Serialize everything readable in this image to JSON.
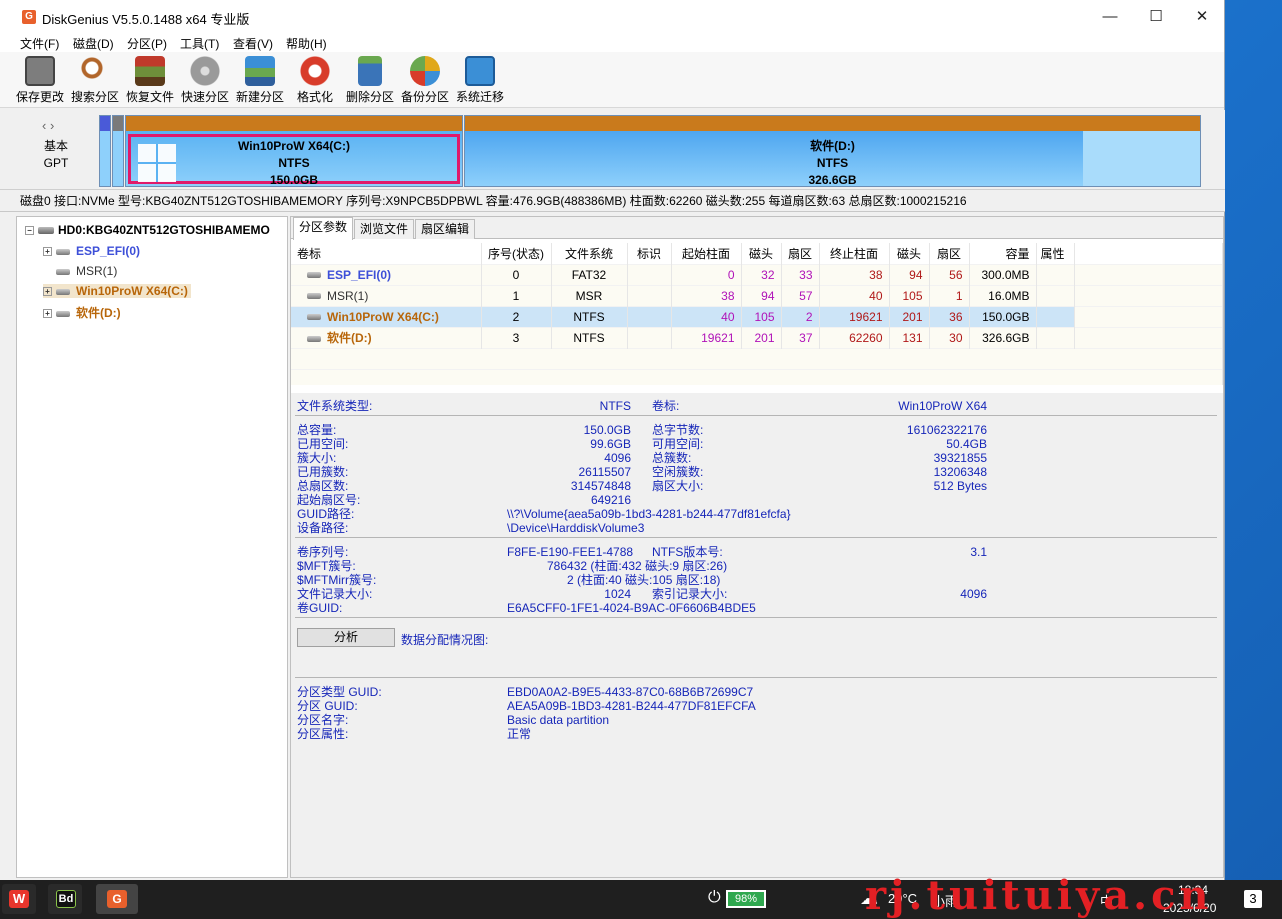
{
  "window": {
    "title": "DiskGenius V5.5.0.1488 x64 专业版",
    "min": "—",
    "max": "☐",
    "close": "✕"
  },
  "menu": [
    "文件(F)",
    "磁盘(D)",
    "分区(P)",
    "工具(T)",
    "查看(V)",
    "帮助(H)"
  ],
  "toolbar": [
    {
      "label": "保存更改",
      "icon": "save-icon",
      "color": "#7d7d7d"
    },
    {
      "label": "搜索分区",
      "icon": "search-icon",
      "color": "#b2662b"
    },
    {
      "label": "恢复文件",
      "icon": "recover-icon",
      "color": "#6e8f3a"
    },
    {
      "label": "快速分区",
      "icon": "quick-partition-icon",
      "color": "#9a9a9a"
    },
    {
      "label": "新建分区",
      "icon": "new-partition-icon",
      "color": "#2f7fc1"
    },
    {
      "label": "格式化",
      "icon": "format-icon",
      "color": "#d83c2a"
    },
    {
      "label": "删除分区",
      "icon": "delete-icon",
      "color": "#3a74b8"
    },
    {
      "label": "备份分区",
      "icon": "backup-icon",
      "color": "#e0a81a"
    },
    {
      "label": "系统迁移",
      "icon": "migrate-icon",
      "color": "#3b8fd6"
    }
  ],
  "diskmap": {
    "label_line1": "基本",
    "label_line2": "GPT",
    "segments": [
      {
        "name": "Win10ProW X64(C:)",
        "fs": "NTFS",
        "size": "150.0GB"
      },
      {
        "name": "软件(D:)",
        "fs": "NTFS",
        "size": "326.6GB"
      }
    ]
  },
  "diskinfo": "磁盘0 接口:NVMe  型号:KBG40ZNT512GTOSHIBAMEMORY  序列号:X9NPCB5DPBWL  容量:476.9GB(488386MB)  柱面数:62260  磁头数:255  每道扇区数:63  总扇区数:1000215216",
  "tree": {
    "root": "HD0:KBG40ZNT512GTOSHIBAMEMO",
    "items": [
      {
        "label": "ESP_EFI(0)",
        "color": "#3d4fd8"
      },
      {
        "label": "MSR(1)",
        "color": "#333333"
      },
      {
        "label": "Win10ProW X64(C:)",
        "color": "#b8660a"
      },
      {
        "label": "软件(D:)",
        "color": "#b8660a"
      }
    ]
  },
  "tabs": [
    "分区参数",
    "浏览文件",
    "扇区编辑"
  ],
  "table": {
    "headers": [
      "卷标",
      "序号(状态)",
      "文件系统",
      "标识",
      "起始柱面",
      "磁头",
      "扇区",
      "终止柱面",
      "磁头",
      "扇区",
      "容量",
      "属性"
    ],
    "rows": [
      {
        "name": "ESP_EFI(0)",
        "idx": "0",
        "fs": "FAT32",
        "sc": "0",
        "sh": "32",
        "ss": "33",
        "ec": "38",
        "eh": "94",
        "es": "56",
        "cap": "300.0MB"
      },
      {
        "name": "MSR(1)",
        "idx": "1",
        "fs": "MSR",
        "sc": "38",
        "sh": "94",
        "ss": "57",
        "ec": "40",
        "eh": "105",
        "es": "1",
        "cap": "16.0MB"
      },
      {
        "name": "Win10ProW X64(C:)",
        "idx": "2",
        "fs": "NTFS",
        "sc": "40",
        "sh": "105",
        "ss": "2",
        "ec": "19621",
        "eh": "201",
        "es": "36",
        "cap": "150.0GB"
      },
      {
        "name": "软件(D:)",
        "idx": "3",
        "fs": "NTFS",
        "sc": "19621",
        "sh": "201",
        "ss": "37",
        "ec": "62260",
        "eh": "131",
        "es": "30",
        "cap": "326.6GB"
      }
    ]
  },
  "details": {
    "fstype_label": "文件系统类型:",
    "fstype": "NTFS",
    "vol_label": "卷标:",
    "vol": "Win10ProW X64",
    "total_label": "总容量:",
    "total": "150.0GB",
    "bytes_label": "总字节数:",
    "bytes": "161062322176",
    "used_label": "已用空间:",
    "used": "99.6GB",
    "free_label": "可用空间:",
    "free": "50.4GB",
    "cluster_label": "簇大小:",
    "cluster": "4096",
    "clusters_label": "总簇数:",
    "clusters": "39321855",
    "usedc_label": "已用簇数:",
    "usedc": "26115507",
    "freec_label": "空闲簇数:",
    "freec": "13206348",
    "sectors_label": "总扇区数:",
    "sectors": "314574848",
    "secsize_label": "扇区大小:",
    "secsize": "512 Bytes",
    "start_label": "起始扇区号:",
    "start": "649216",
    "guidpath_label": "GUID路径:",
    "guidpath": "\\\\?\\Volume{aea5a09b-1bd3-4281-b244-477df81efcfa}",
    "devpath_label": "设备路径:",
    "devpath": "\\Device\\HarddiskVolume3",
    "serial_label": "卷序列号:",
    "serial": "F8FE-E190-FEE1-4788",
    "ntfsver_label": "NTFS版本号:",
    "ntfsver": "3.1",
    "mft_label": "$MFT簇号:",
    "mft": "786432 (柱面:432 磁头:9 扇区:26)",
    "mftmirr_label": "$MFTMirr簇号:",
    "mftmirr": "2 (柱面:40 磁头:105 扇区:18)",
    "rec_label": "文件记录大小:",
    "rec": "1024",
    "idx_label": "索引记录大小:",
    "idx": "4096",
    "volguid_label": "卷GUID:",
    "volguid": "E6A5CFF0-1FE1-4024-B9AC-0F6606B4BDE5",
    "analyze": "分析",
    "map_label": "数据分配情况图:",
    "ptguid_label": "分区类型 GUID:",
    "ptguid": "EBD0A0A2-B9E5-4433-87C0-68B6B72699C7",
    "pguid_label": "分区 GUID:",
    "pguid": "AEA5A09B-1BD3-4281-B244-477DF81EFCFA",
    "pname_label": "分区名字:",
    "pname": "Basic data partition",
    "pattr_label": "分区属性:",
    "pattr": "正常"
  },
  "taskbar": {
    "battery": "98%",
    "temp": "29°C",
    "weather": "小雨",
    "ime": "中",
    "time": "18:34",
    "date": "2025/6/20",
    "notif": "3"
  },
  "watermark": "rj.tuituiya.cn"
}
